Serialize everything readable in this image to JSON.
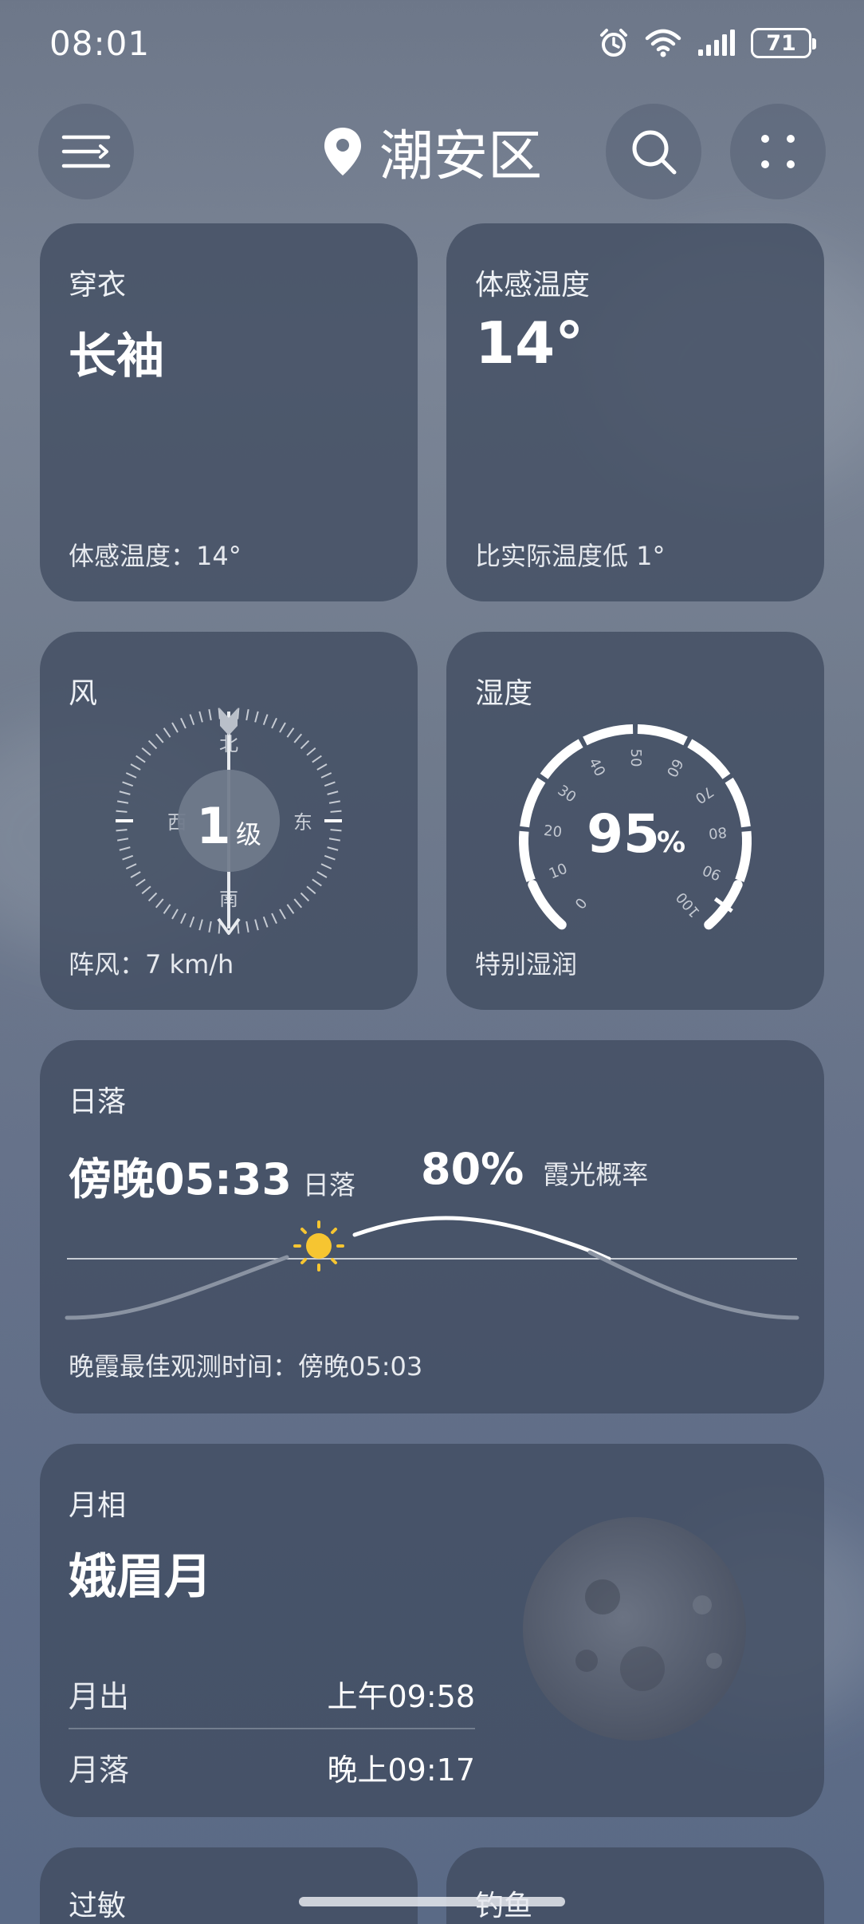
{
  "status_bar": {
    "time": "08:01",
    "battery": "71"
  },
  "header": {
    "location": "潮安区"
  },
  "cards": {
    "clothing": {
      "label": "穿衣",
      "value": "长袖",
      "footer": "体感温度：14°"
    },
    "feels_like": {
      "label": "体感温度",
      "value": "14°",
      "footer": "比实际温度低 1°"
    },
    "wind": {
      "label": "风",
      "level": "1",
      "level_unit": "级",
      "dir_n": "北",
      "dir_s": "南",
      "dir_e": "东",
      "dir_w": "西",
      "footer": "阵风：7 km/h"
    },
    "humidity": {
      "label": "湿度",
      "value": "95",
      "unit": "%",
      "footer": "特别湿润",
      "ticks": [
        "0",
        "10",
        "20",
        "30",
        "40",
        "50",
        "60",
        "70",
        "80",
        "90",
        "100"
      ],
      "percent": 95
    },
    "sunset": {
      "label": "日落",
      "time": "傍晚05:33",
      "time_suffix": "日落",
      "glow_prob": "80%",
      "glow_label": "霞光概率",
      "footer": "晚霞最佳观测时间：傍晚05:03"
    },
    "moon": {
      "label": "月相",
      "phase": "娥眉月",
      "rise_label": "月出",
      "rise_time": "上午09:58",
      "set_label": "月落",
      "set_time": "晚上09:17"
    },
    "allergy": {
      "label": "过敏"
    },
    "fishing": {
      "label": "钓鱼"
    }
  }
}
